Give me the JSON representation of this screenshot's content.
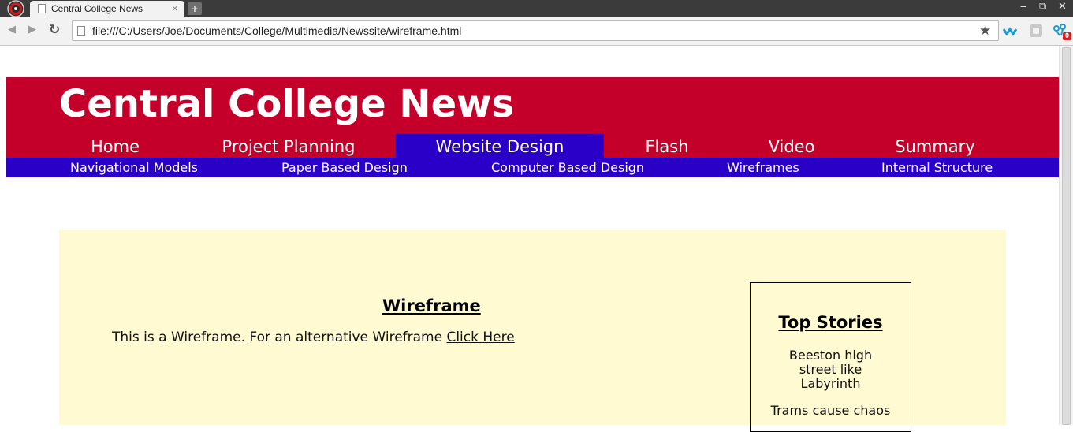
{
  "browser": {
    "tab_title": "Central College News",
    "tab_close": "×",
    "new_tab": "+",
    "url": "file:///C:/Users/Joe/Documents/College/Multimedia/Newssite/wireframe.html",
    "window_controls": {
      "minimize": "‒",
      "restore": "⧉",
      "close": "✕"
    },
    "nav": {
      "back": "◀",
      "forward": "▶",
      "reload": "↻",
      "bookmark": "★"
    },
    "extension_badge": "0"
  },
  "site": {
    "title": "Central College News",
    "colors": {
      "header": "#c4002a",
      "nav_active": "#2a00c8",
      "subnav": "#2a00c8",
      "content_bg": "#fffad2"
    },
    "main_nav": [
      {
        "label": "Home"
      },
      {
        "label": "Project Planning"
      },
      {
        "label": "Website Design",
        "active": true
      },
      {
        "label": "Flash"
      },
      {
        "label": "Video"
      },
      {
        "label": "Summary"
      }
    ],
    "sub_nav": [
      {
        "label": "Navigational Models"
      },
      {
        "label": "Paper Based Design"
      },
      {
        "label": "Computer Based Design"
      },
      {
        "label": "Wireframes"
      },
      {
        "label": "Internal Structure"
      }
    ]
  },
  "content": {
    "heading": "Wireframe",
    "intro_text": "This is a Wireframe. For an alternative Wireframe ",
    "intro_link": "Click Here"
  },
  "top_stories": {
    "title": "Top Stories",
    "items": [
      {
        "line1": "Beeston high",
        "line2": "street like",
        "line3": "Labyrinth"
      },
      {
        "line1": "Trams cause chaos"
      }
    ]
  }
}
